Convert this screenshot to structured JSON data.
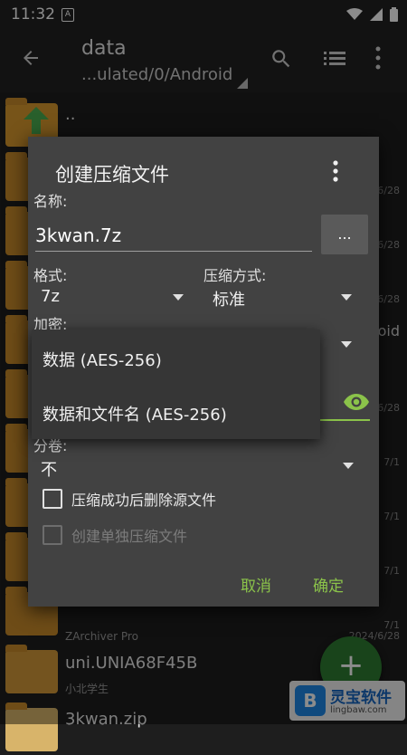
{
  "status_bar": {
    "time": "11:32",
    "notification_letter": "A"
  },
  "toolbar": {
    "title": "data",
    "path": "...ulated/0/Android"
  },
  "file_list": [
    {
      "name": "..",
      "date": ""
    },
    {
      "name": "",
      "date": "6/28"
    },
    {
      "name": "",
      "date": "6/28"
    },
    {
      "name": "",
      "date": "6/28"
    },
    {
      "name": "",
      "date": "oid"
    },
    {
      "name": "",
      "date": "6/28"
    },
    {
      "name": "",
      "date": "7/1"
    },
    {
      "name": "",
      "date": "7/1"
    },
    {
      "name": "",
      "date": "7/1"
    },
    {
      "name": "",
      "date": "7/1"
    },
    {
      "name": "",
      "date": "2024/6/28"
    }
  ],
  "bottom_items": [
    {
      "sub": "ZArchiver Pro",
      "date": "2024/6/28"
    },
    {
      "name": "uni.UNIA68F45B",
      "sub": "小北学生"
    },
    {
      "name": "3kwan.zip"
    }
  ],
  "dialog": {
    "title": "创建压缩文件",
    "name_label": "名称:",
    "name_value": "3kwan.7z",
    "browse_label": "...",
    "format_label": "格式:",
    "format_value": "7z",
    "method_label": "压缩方式:",
    "method_value": "标准",
    "encrypt_label": "加密:",
    "split_label": "分卷:",
    "split_value": "不",
    "delete_after": "压缩成功后删除源文件",
    "separate_archives": "创建单独压缩文件",
    "cancel": "取消",
    "ok": "确定"
  },
  "dropdown": {
    "options": [
      "数据 (AES-256)",
      "数据和文件名 (AES-256)"
    ]
  },
  "fab_label": "+",
  "watermark": {
    "logo_letter": "B",
    "title": "灵宝软件",
    "url": "lingbaw.com"
  },
  "colors": {
    "accent": "#8bc34a",
    "fab": "#2e7d32",
    "folder": "#c98b2b",
    "dialog": "#424242"
  }
}
